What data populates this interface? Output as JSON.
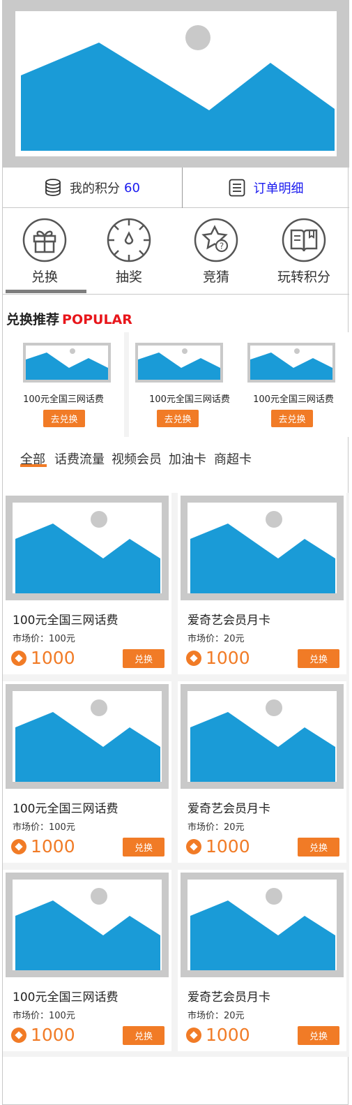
{
  "points": {
    "label": "我的积分",
    "value": "60",
    "order_label": "订单明细"
  },
  "categories": [
    {
      "label": "兑换",
      "icon": "gift-icon"
    },
    {
      "label": "抽奖",
      "icon": "lottery-wheel-icon"
    },
    {
      "label": "竞猜",
      "icon": "question-star-icon"
    },
    {
      "label": "玩转积分",
      "icon": "book-icon"
    }
  ],
  "popular": {
    "title": "兑换推荐",
    "title_en": "POPULAR",
    "items": [
      {
        "name": "100元全国三网话费",
        "button": "去兑换"
      },
      {
        "name": "100元全国三网话费",
        "button": "去兑换"
      },
      {
        "name": "100元全国三网话费",
        "button": "去兑换"
      }
    ]
  },
  "tabs": [
    "全部",
    "话费流量",
    "视频会员",
    "加油卡",
    "商超卡"
  ],
  "products": [
    {
      "title": "100元全国三网话费",
      "price": "市场价：100元",
      "points": "1000",
      "button": "兑换"
    },
    {
      "title": "爱奇艺会员月卡",
      "price": "市场价：20元",
      "points": "1000",
      "button": "兑换"
    },
    {
      "title": "100元全国三网话费",
      "price": "市场价：100元",
      "points": "1000",
      "button": "兑换"
    },
    {
      "title": "爱奇艺会员月卡",
      "price": "市场价：20元",
      "points": "1000",
      "button": "兑换"
    },
    {
      "title": "100元全国三网话费",
      "price": "市场价：100元",
      "points": "1000",
      "button": "兑换"
    },
    {
      "title": "爱奇艺会员月卡",
      "price": "市场价：20元",
      "points": "1000",
      "button": "兑换"
    }
  ],
  "colors": {
    "accent": "#f17b26",
    "link": "#1a1aef",
    "popular_red": "#e8161b",
    "placeholder_blue": "#1a9bd7",
    "placeholder_gray": "#c9c9c9"
  }
}
